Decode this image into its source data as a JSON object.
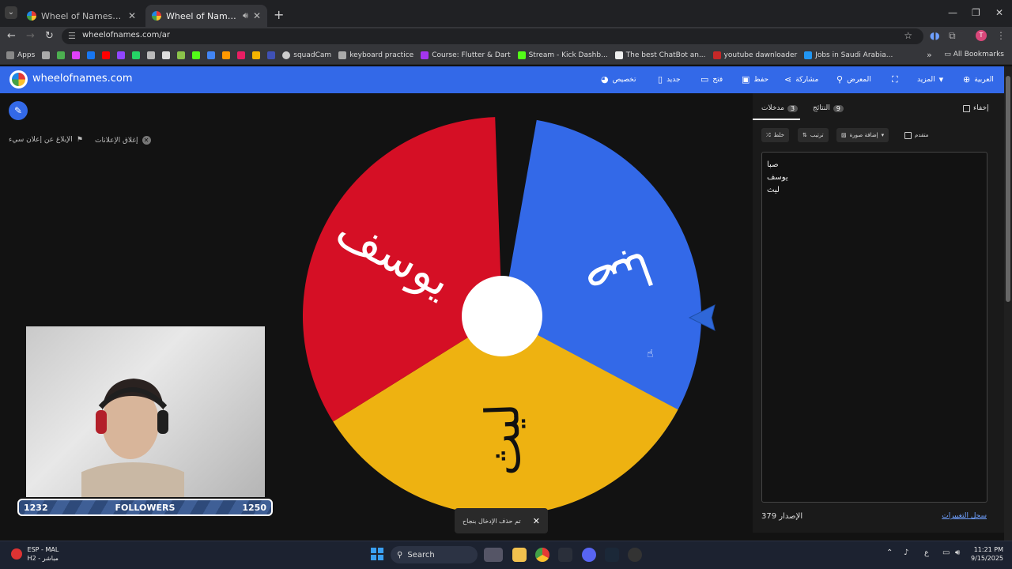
{
  "browser": {
    "tabs": [
      {
        "title": "Wheel of Names | اسم العشوائي"
      },
      {
        "title": "Wheel of Names | العشوائي"
      }
    ],
    "url": "wheelofnames.com/ar",
    "bookmarks": [
      {
        "label": "Apps"
      },
      {
        "label": "squadCam"
      },
      {
        "label": "keyboard practice"
      },
      {
        "label": "Course: Flutter & Dart"
      },
      {
        "label": "Stream - Kick Dashb..."
      },
      {
        "label": "The best ChatBot an..."
      },
      {
        "label": "youtube dawnloader"
      },
      {
        "label": "Jobs in Saudi Arabia..."
      }
    ],
    "all_bookmarks": "All Bookmarks"
  },
  "site": {
    "logo": "wheelofnames.com",
    "menu": {
      "customize": "تخصيص",
      "new": "جديد",
      "open": "فتح",
      "save": "حفظ",
      "share": "مشاركة",
      "gallery": "المعرض",
      "more": "المزيد",
      "language": "العربية"
    },
    "report_ad": "الإبلاغ عن إعلان سيء",
    "close_ads": "إغلاق الإعلانات"
  },
  "wheel": {
    "segments": [
      {
        "label": "صبا",
        "color": "#3369e8"
      },
      {
        "label": "ليث",
        "color": "#eeb211"
      },
      {
        "label": "يوسف",
        "color": "#d50f25"
      }
    ]
  },
  "stream": {
    "followers_label": "FOLLOWERS",
    "current": "1232",
    "goal": "1250"
  },
  "panel": {
    "tab_entries": "مدخلات",
    "entries_count": "3",
    "tab_results": "النتائج",
    "results_count": "9",
    "hide": "إخفاء",
    "shuffle": "خلط",
    "sort": "ترتيب",
    "add_image": "إضافة صورة",
    "advanced": "متقدم",
    "entries": [
      "صبا",
      "يوسف",
      "ليث"
    ],
    "version_label": "الإصدار 379",
    "changelog": "سجل التغييرات"
  },
  "toast": {
    "message": "تم حذف الإدخال بنجاح"
  },
  "taskbar": {
    "weather_line1": "ESP - MAL",
    "weather_line2": "H2 - مباشر",
    "search": "Search",
    "time": "11:21 PM",
    "date": "9/15/2025",
    "lang": "ع"
  }
}
